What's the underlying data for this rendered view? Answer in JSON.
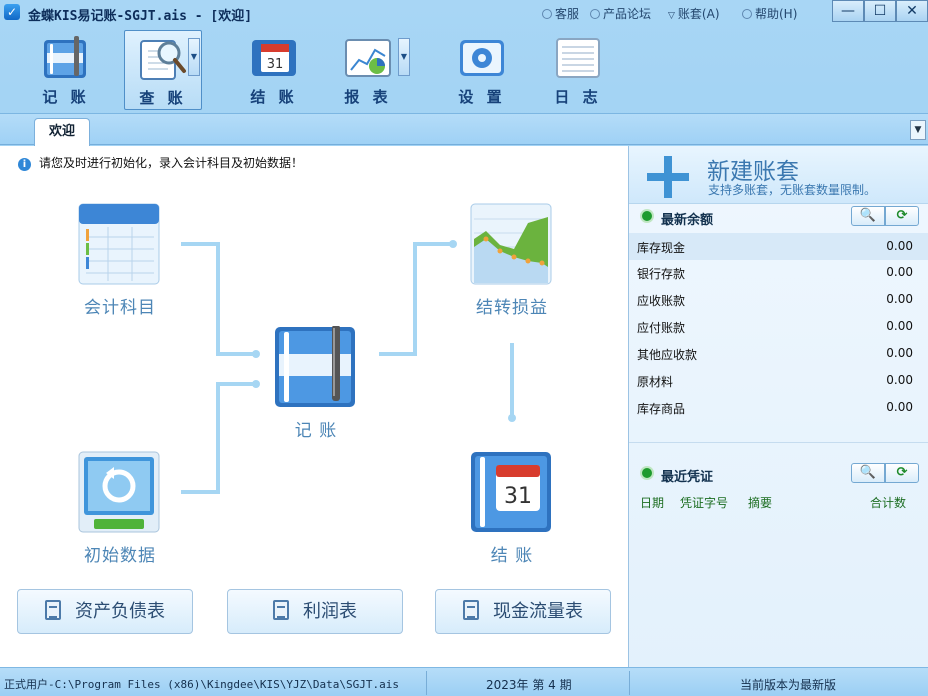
{
  "title": "金蝶KIS易记账-SGJT.ais - [欢迎]",
  "topmenu": {
    "support": "客服",
    "forum": "产品论坛",
    "account": "账套(A)",
    "help": "帮助(H)"
  },
  "window_controls": {
    "minimize": "—",
    "maximize": "☐",
    "close": "✕"
  },
  "toolbar": [
    {
      "label": "记 账",
      "icon": "ledger-pen-icon"
    },
    {
      "label": "查 账",
      "icon": "search-ledger-icon"
    },
    {
      "label": "结 账",
      "icon": "calendar-icon"
    },
    {
      "label": "报 表",
      "icon": "chart-report-icon"
    },
    {
      "label": "设 置",
      "icon": "gear-icon"
    },
    {
      "label": "日 志",
      "icon": "log-icon"
    }
  ],
  "tabs": [
    {
      "label": "欢迎"
    }
  ],
  "notice": "请您及时进行初始化，录入会计科目及初始数据！",
  "flow": {
    "accounts": "会计科目",
    "initial": "初始数据",
    "bookkeeping": "记  账",
    "carryover": "结转损益",
    "closing": "结  账"
  },
  "reports": {
    "balance_sheet": "资产负债表",
    "income": "利润表",
    "cashflow": "现金流量表"
  },
  "newbook": {
    "title": "新建账套",
    "subtitle": "支持多账套，无账套数量限制。"
  },
  "balances": {
    "header": "最新余额",
    "rows": [
      {
        "name": "库存现金",
        "value": "0.00"
      },
      {
        "name": "银行存款",
        "value": "0.00"
      },
      {
        "name": "应收账款",
        "value": "0.00"
      },
      {
        "name": "应付账款",
        "value": "0.00"
      },
      {
        "name": "其他应收款",
        "value": "0.00"
      },
      {
        "name": "原材料",
        "value": "0.00"
      },
      {
        "name": "库存商品",
        "value": "0.00"
      }
    ]
  },
  "vouchers": {
    "header": "最近凭证",
    "cols": [
      "日期",
      "凭证字号",
      "摘要",
      "合计数"
    ]
  },
  "status": {
    "path": "正式用户-C:\\Program Files (x86)\\Kingdee\\KIS\\YJZ\\Data\\SGJT.ais",
    "period": "2023年 第 4 期",
    "version": "当前版本为最新版"
  },
  "colors": {
    "accent": "#3f93d4",
    "green": "#1e9b2e"
  }
}
